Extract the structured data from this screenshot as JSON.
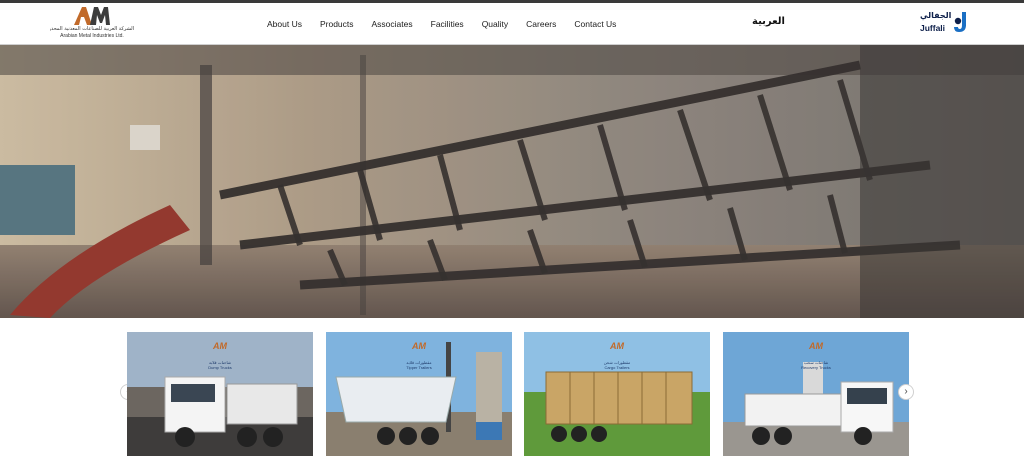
{
  "header": {
    "logo": {
      "mark": "AM",
      "arabic_name": "الشركة العربية للصناعات المعدنية المحدودة",
      "english_name": "Arabian Metal Industries Ltd."
    },
    "nav": [
      {
        "label": "About Us"
      },
      {
        "label": "Products"
      },
      {
        "label": "Associates"
      },
      {
        "label": "Facilities"
      },
      {
        "label": "Quality"
      },
      {
        "label": "Careers"
      },
      {
        "label": "Contact Us"
      }
    ],
    "language_switch": "العربية",
    "partner_logo": {
      "arabic": "الجفالي",
      "english": "Juffali"
    }
  },
  "hero": {
    "alt": "steel frame being lifted in factory hall"
  },
  "carousel": {
    "prev_icon": "chevron-left-icon",
    "next_icon": "chevron-right-icon",
    "cards": [
      {
        "mark": "AM",
        "subject": "dump-truck-icon",
        "line1": "شاحنات قلابة",
        "line2": "Dump Trucks"
      },
      {
        "mark": "AM",
        "subject": "tipper-trailer-icon",
        "line1": "مقطورات قلابة",
        "line2": "Tipper Trailers"
      },
      {
        "mark": "AM",
        "subject": "cargo-trailer-icon",
        "line1": "مقطورات شحن",
        "line2": "Cargo Trailers"
      },
      {
        "mark": "AM",
        "subject": "recovery-truck-icon",
        "line1": "شاحنات سحب",
        "line2": "Recovery Trucks"
      }
    ]
  },
  "colors": {
    "brand_orange": "#c16a2a",
    "juffali_blue": "#1a6fc4",
    "nav_text": "#1c1c1c"
  }
}
